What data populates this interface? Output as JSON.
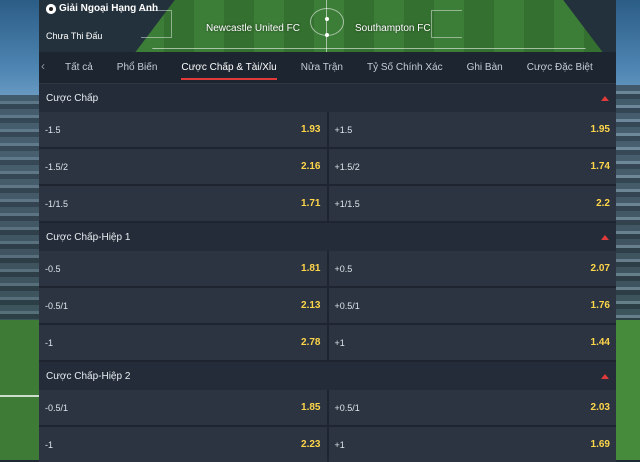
{
  "match": {
    "league": "Giải Ngoại Hạng Anh",
    "status": "Chưa Thi Đấu",
    "home_team": "Newcastle United FC",
    "away_team": "Southampton FC"
  },
  "tabs": [
    {
      "label": "Tất cả"
    },
    {
      "label": "Phổ Biến"
    },
    {
      "label": "Cược Chấp & Tài/Xỉu",
      "active": true
    },
    {
      "label": "Nửa Trận"
    },
    {
      "label": "Tỷ Số Chính Xác"
    },
    {
      "label": "Ghi Bàn"
    },
    {
      "label": "Cược Đặc Biệt"
    }
  ],
  "colors": {
    "accent": "#e03a3a",
    "odds": "#ffd54a",
    "panel": "#1e2530",
    "cell": "#2b3440"
  },
  "sections": [
    {
      "title": "Cược Chấp",
      "rows": [
        {
          "left_line": "-1.5",
          "left_odds": "1.93",
          "right_line": "+1.5",
          "right_odds": "1.95"
        },
        {
          "left_line": "-1.5/2",
          "left_odds": "2.16",
          "right_line": "+1.5/2",
          "right_odds": "1.74"
        },
        {
          "left_line": "-1/1.5",
          "left_odds": "1.71",
          "right_line": "+1/1.5",
          "right_odds": "2.2"
        }
      ]
    },
    {
      "title": "Cược Chấp-Hiệp 1",
      "rows": [
        {
          "left_line": "-0.5",
          "left_odds": "1.81",
          "right_line": "+0.5",
          "right_odds": "2.07"
        },
        {
          "left_line": "-0.5/1",
          "left_odds": "2.13",
          "right_line": "+0.5/1",
          "right_odds": "1.76"
        },
        {
          "left_line": "-1",
          "left_odds": "2.78",
          "right_line": "+1",
          "right_odds": "1.44"
        }
      ]
    },
    {
      "title": "Cược Chấp-Hiệp 2",
      "rows": [
        {
          "left_line": "-0.5/1",
          "left_odds": "1.85",
          "right_line": "+0.5/1",
          "right_odds": "2.03"
        },
        {
          "left_line": "-1",
          "left_odds": "2.23",
          "right_line": "+1",
          "right_odds": "1.69"
        }
      ]
    }
  ]
}
